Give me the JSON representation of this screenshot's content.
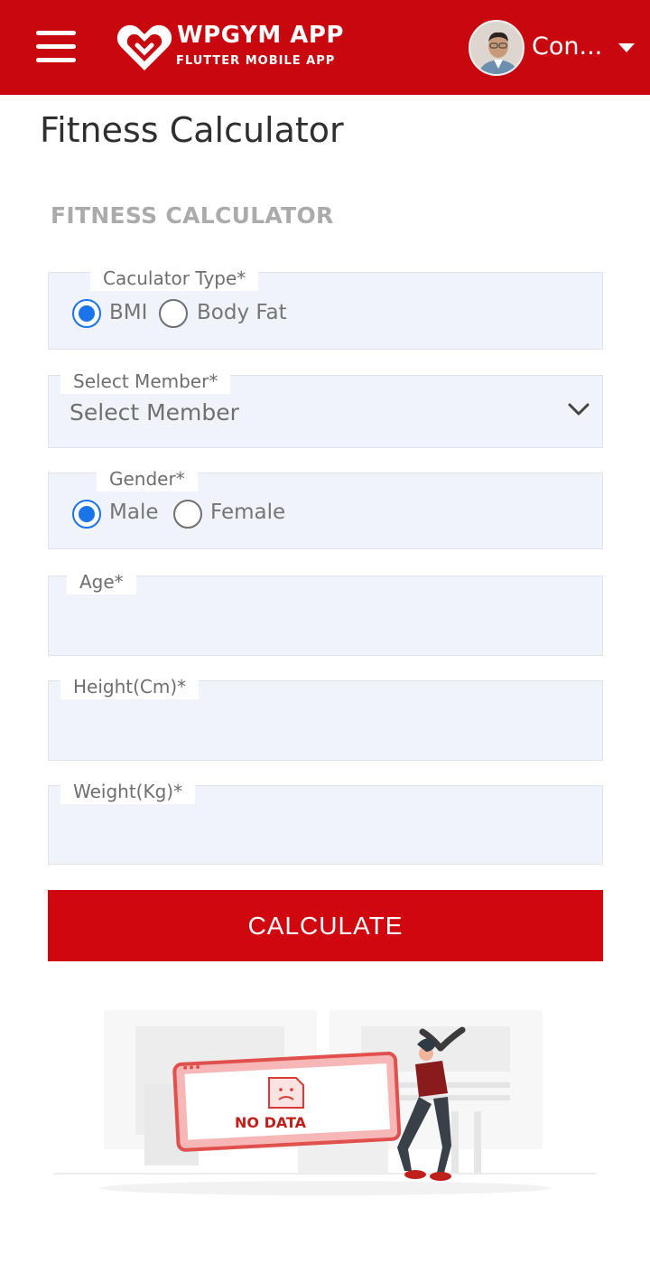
{
  "header": {
    "brand_title": "WPGYM APP",
    "brand_subtitle": "FLUTTER MOBILE APP",
    "user_name": "Con...",
    "icons": {
      "menu": "hamburger-menu-icon",
      "logo": "heart-logo-icon",
      "dropdown": "caret-down-icon"
    },
    "colors": {
      "bar": "#c8070f"
    }
  },
  "page": {
    "title": "Fitness Calculator",
    "section_title": "FITNESS CALCULATOR"
  },
  "form": {
    "calculator_type": {
      "legend": "Caculator Type*",
      "options": [
        "BMI",
        "Body Fat"
      ],
      "selected": "BMI"
    },
    "member": {
      "legend": "Select Member*",
      "value": "Select Member"
    },
    "gender": {
      "legend": "Gender*",
      "options": [
        "Male",
        "Female"
      ],
      "selected": "Male"
    },
    "age": {
      "legend": "Age*",
      "value": ""
    },
    "height": {
      "legend": "Height(Cm)*",
      "value": ""
    },
    "weight": {
      "legend": "Weight(Kg)*",
      "value": ""
    },
    "submit_label": "CALCULATE",
    "colors": {
      "button": "#d0070f",
      "radio_selected": "#1a73e8",
      "field_bg": "#f0f4fa"
    }
  },
  "empty_state": {
    "illustration_text": "NO DATA",
    "icons": {
      "sad_document": "sad-document-icon"
    }
  }
}
